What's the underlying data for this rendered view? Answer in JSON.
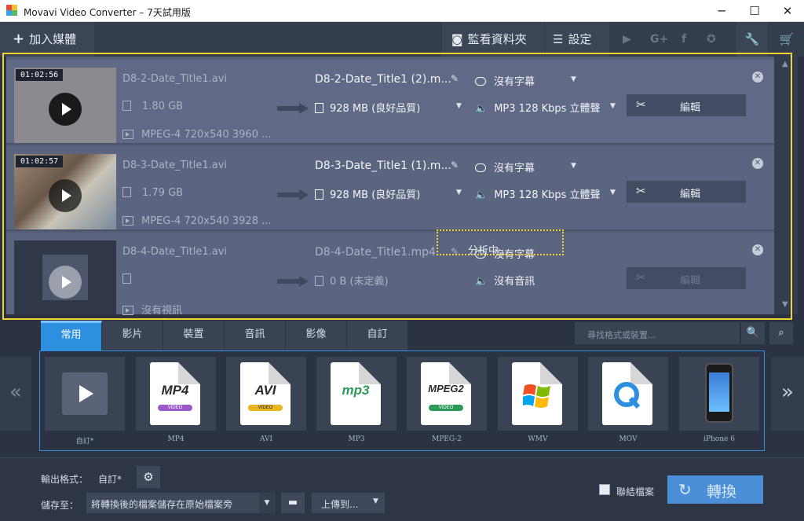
{
  "window": {
    "title": "Movavi Video Converter – 7天試用版",
    "minimize": "─",
    "maximize": "☐",
    "close": "✕"
  },
  "toolbar": {
    "add_media": "加入媒體",
    "watch_folder": "監看資料夾",
    "settings": "設定",
    "social_icons": [
      "youtube-icon",
      "google-plus-icon",
      "facebook-icon",
      "vk-icon"
    ]
  },
  "files": [
    {
      "duration": "01:02:56",
      "source_name": "D8-2-Date_Title1.avi",
      "source_size": "1.80 GB",
      "source_meta": "MPEG-4 720x540 3960 ...",
      "output_name": "D8-2-Date_Title1 (2).m...",
      "output_size": "928 MB (良好品質)",
      "subtitle": "沒有字幕",
      "audio": "MP3 128 Kbps 立體聲",
      "edit": "編輯"
    },
    {
      "duration": "01:02:57",
      "source_name": "D8-3-Date_Title1.avi",
      "source_size": "1.79 GB",
      "source_meta": "MPEG-4 720x540 3928 ...",
      "output_name": "D8-3-Date_Title1 (1).m...",
      "output_size": "928 MB (良好品質)",
      "subtitle": "沒有字幕",
      "audio": "MP3 128 Kbps 立體聲",
      "edit": "編輯"
    },
    {
      "duration": "",
      "source_name": "D8-4-Date_Title1.avi",
      "source_size": "",
      "source_meta": "沒有視訊",
      "output_name": "D8-4-Date_Title1.mp4",
      "output_size": "0 B (未定義)",
      "subtitle": "沒有字幕",
      "audio": "沒有音訊",
      "edit": "編輯",
      "status": "分析中..."
    }
  ],
  "tabs": [
    "常用",
    "影片",
    "裝置",
    "音訊",
    "影像",
    "自訂"
  ],
  "active_tab": "常用",
  "search_placeholder": "尋找格式或裝置...",
  "formats": [
    {
      "label": "自訂*",
      "icon": "custom-video-icon"
    },
    {
      "label": "MP4",
      "icon": "mp4-icon",
      "text": "MP4",
      "stripe": "VIDEO",
      "color": "#9b59c9"
    },
    {
      "label": "AVI",
      "icon": "avi-icon",
      "text": "AVI",
      "stripe": "VIDEO",
      "color": "#e8b51e"
    },
    {
      "label": "MP3",
      "icon": "mp3-icon",
      "text": "mp3",
      "stripe": "",
      "color": "#2e9a5a"
    },
    {
      "label": "MPEG-2",
      "icon": "mpeg2-icon",
      "text": "MPEG2",
      "stripe": "VIDEO",
      "color": "#2e9a5a"
    },
    {
      "label": "WMV",
      "icon": "wmv-icon"
    },
    {
      "label": "MOV",
      "icon": "mov-icon"
    },
    {
      "label": "iPhone 6",
      "icon": "iphone-icon"
    }
  ],
  "bottom": {
    "output_format_label": "輸出格式：",
    "output_format_value": "自訂*",
    "save_to_label": "儲存至：",
    "save_to_value": "將轉換後的檔案儲存在原始檔案旁",
    "upload": "上傳到...",
    "join_files": "聯結檔案",
    "convert": "轉換"
  },
  "colors": {
    "accent": "#2d8fe0",
    "highlight": "#f2d430",
    "convert": "#4a8fd8"
  }
}
